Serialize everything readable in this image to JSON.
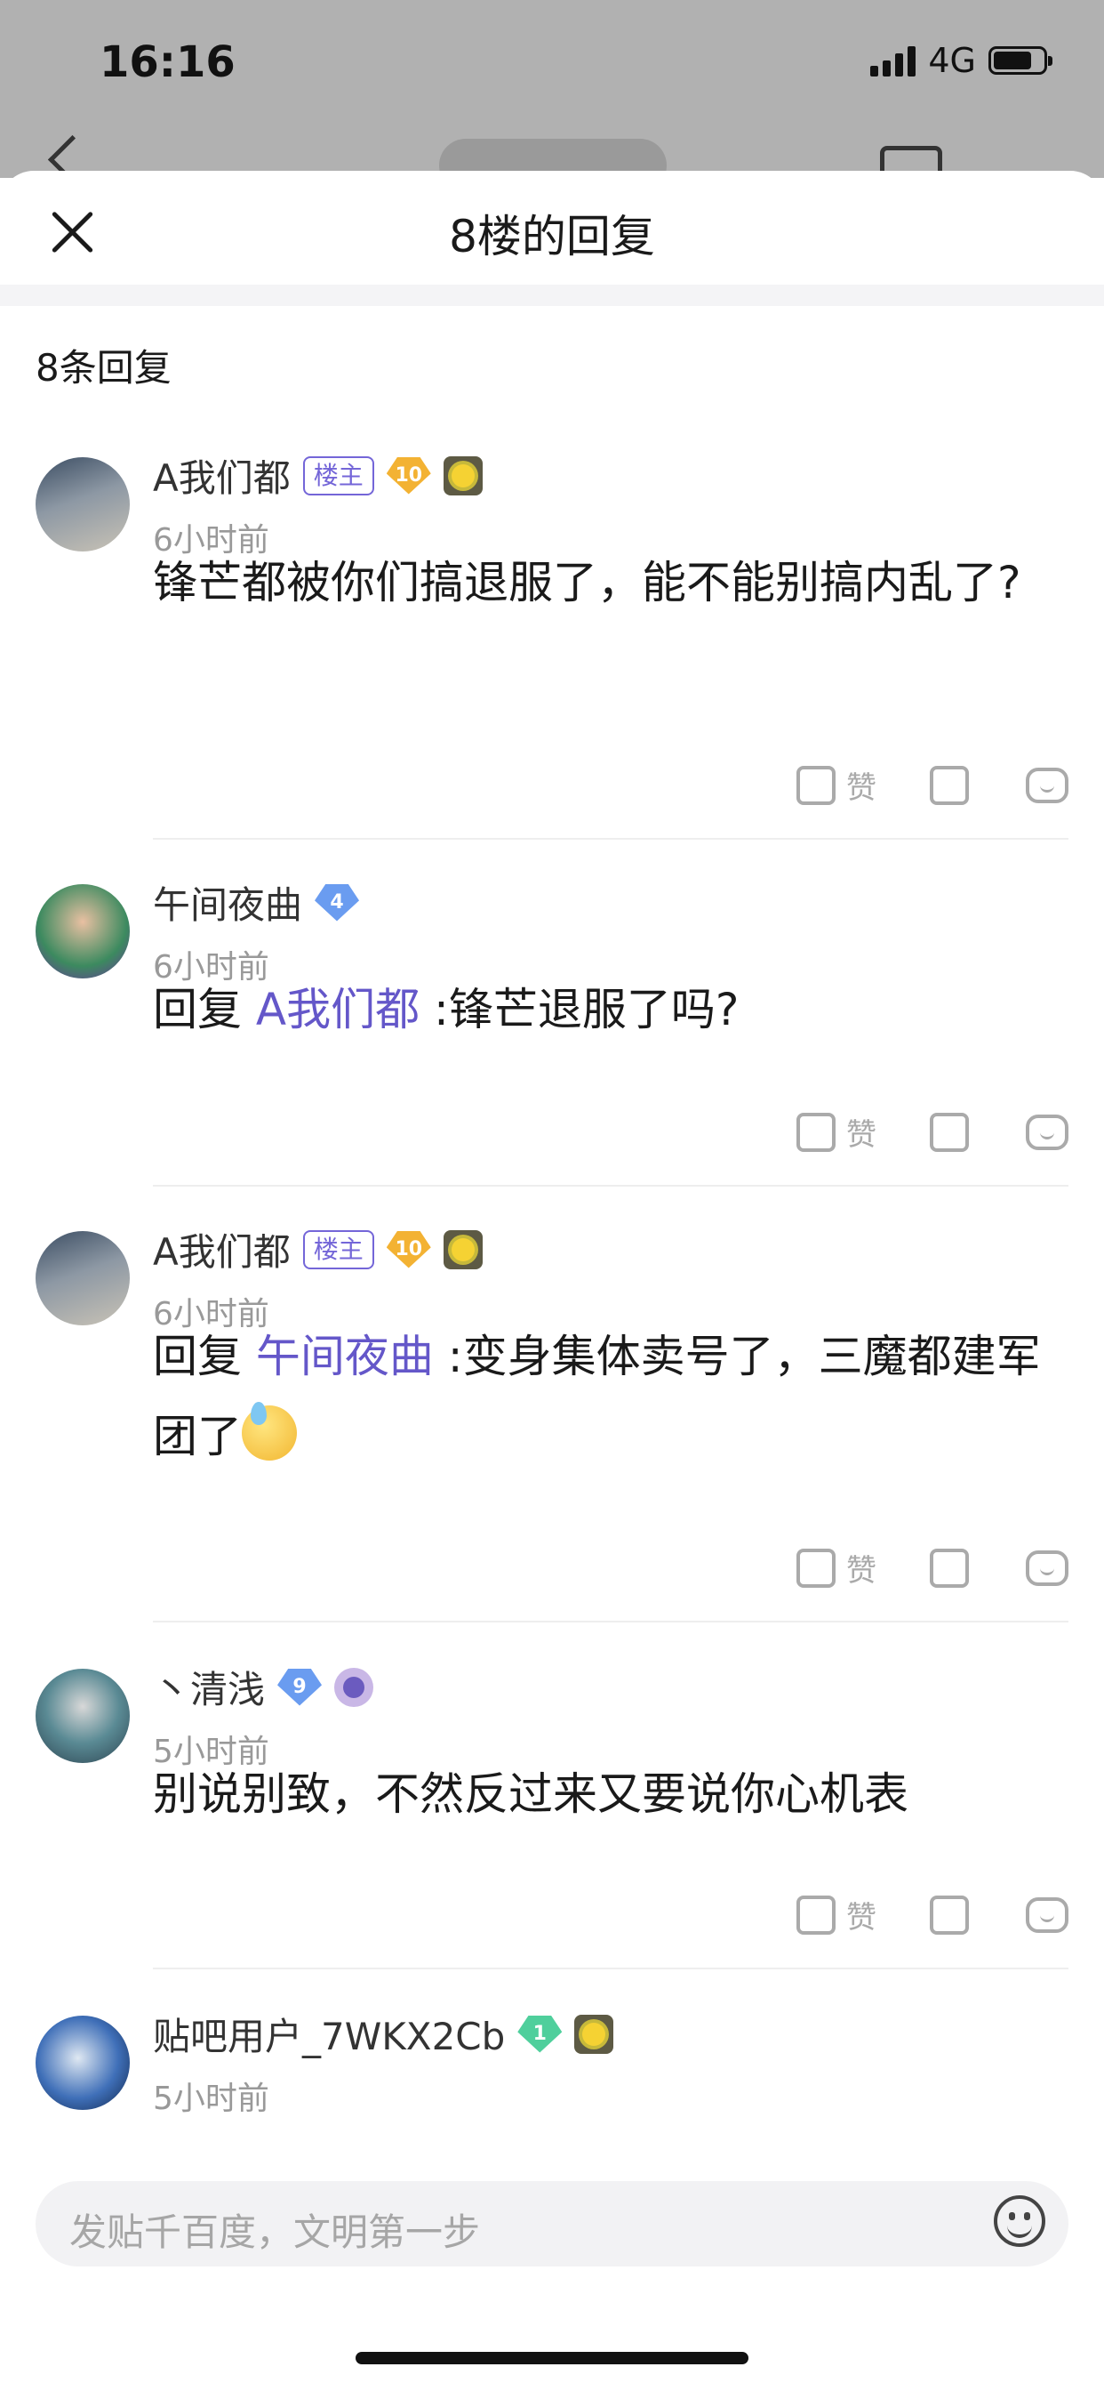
{
  "status_bar": {
    "time": "16:16",
    "network": "4G"
  },
  "sheet": {
    "title": "8楼的回复",
    "reply_count": "8条回复",
    "like_label": "赞"
  },
  "comments": [
    {
      "username": "A我们都",
      "badge": "楼主",
      "level": "10",
      "time": "6小时前",
      "text": "锋芒都被你们搞退服了，能不能别搞内乱了?"
    },
    {
      "username": "午间夜曲",
      "level": "4",
      "time": "6小时前",
      "prefix": "回复",
      "mention": "A我们都",
      "text": " :锋芒退服了吗?"
    },
    {
      "username": "A我们都",
      "badge": "楼主",
      "level": "10",
      "time": "6小时前",
      "prefix": "回复",
      "mention": "午间夜曲",
      "text": " :变身集体卖号了，三魔都建军团了"
    },
    {
      "username": "丶清浅",
      "level": "9",
      "time": "5小时前",
      "text": "别说别致，不然反过来又要说你心机表"
    },
    {
      "username": "贴吧用户_7WKX2Cb",
      "level": "1",
      "time": "5小时前"
    }
  ],
  "input": {
    "placeholder": "发贴千百度，文明第一步"
  },
  "icons": [
    "close-icon",
    "thumb-up-icon",
    "thumb-down-icon",
    "reply-icon",
    "emoji-icon"
  ],
  "colors": {
    "accent": "#6457c9",
    "muted": "#999999"
  }
}
